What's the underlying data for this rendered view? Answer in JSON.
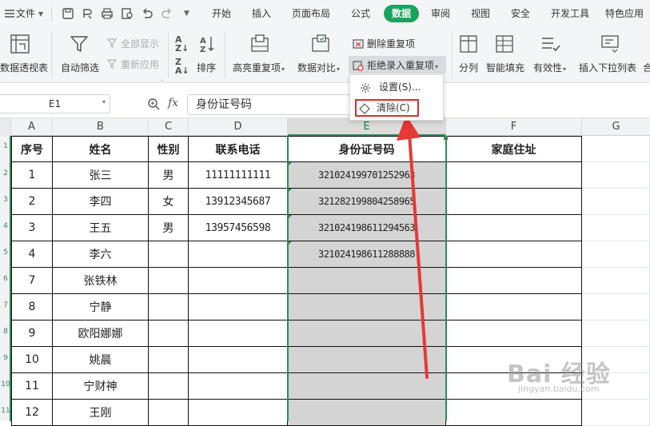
{
  "menubar": {
    "file_label": "文件",
    "tabs": [
      "开始",
      "插入",
      "页面布局",
      "公式",
      "数据",
      "审阅",
      "视图",
      "安全",
      "开发工具",
      "特色应用"
    ],
    "active_tab": "数据"
  },
  "ribbon": {
    "pivot_label": "数据透视表",
    "autofilter_label": "自动筛选",
    "show_all_label": "全部显示",
    "reapply_label": "重新应用",
    "sort_label": "排序",
    "highlight_dup_label": "高亮重复项",
    "compare_label": "数据对比",
    "remove_dup_label": "删除重复项",
    "reject_dup_label": "拒绝录入重复项",
    "split_label": "分列",
    "smart_fill_label": "智能填充",
    "validity_label": "有效性",
    "dropdown_list_label": "插入下拉列表",
    "merge_calc_label": "合"
  },
  "dropdown_menu": {
    "items": [
      "设置(S)...",
      "清除(C)"
    ],
    "highlight_color": "#d9302c"
  },
  "formula_bar": {
    "cell_ref": "E1",
    "fx_label": "fx",
    "content": "身份证号码"
  },
  "grid": {
    "columns": [
      "A",
      "B",
      "C",
      "D",
      "E",
      "F",
      "G"
    ],
    "selected_column": "E",
    "header_row": [
      "序号",
      "姓名",
      "性别",
      "联系电话",
      "身份证号码",
      "家庭住址"
    ],
    "rows": [
      [
        "1",
        "张三",
        "男",
        "11111111111",
        "321024199701252963",
        ""
      ],
      [
        "2",
        "李四",
        "女",
        "13912345687",
        "321282199804258965",
        ""
      ],
      [
        "3",
        "王五",
        "男",
        "13957456598",
        "321024198611294563",
        ""
      ],
      [
        "4",
        "李六",
        "",
        "",
        "321024198611288888",
        ""
      ],
      [
        "7",
        "张铁林",
        "",
        "",
        "",
        ""
      ],
      [
        "8",
        "宁静",
        "",
        "",
        "",
        ""
      ],
      [
        "9",
        "欧阳娜娜",
        "",
        "",
        "",
        ""
      ],
      [
        "10",
        "姚晨",
        "",
        "",
        "",
        ""
      ],
      [
        "11",
        "宁财神",
        "",
        "",
        "",
        ""
      ],
      [
        "12",
        "王刚",
        "",
        "",
        "",
        ""
      ]
    ],
    "row_numbers": [
      "1",
      "2",
      "3",
      "4",
      "5",
      "6",
      "7",
      "8",
      "9",
      "10",
      "11"
    ]
  },
  "colors": {
    "accent_green": "#1aa35c",
    "selection_green": "#2e8b57",
    "arrow_red": "#e53935",
    "selected_fill": "#d4d4d4"
  },
  "watermark": {
    "main": "Bai 经验",
    "sub": "jingyan.baidu.com"
  }
}
